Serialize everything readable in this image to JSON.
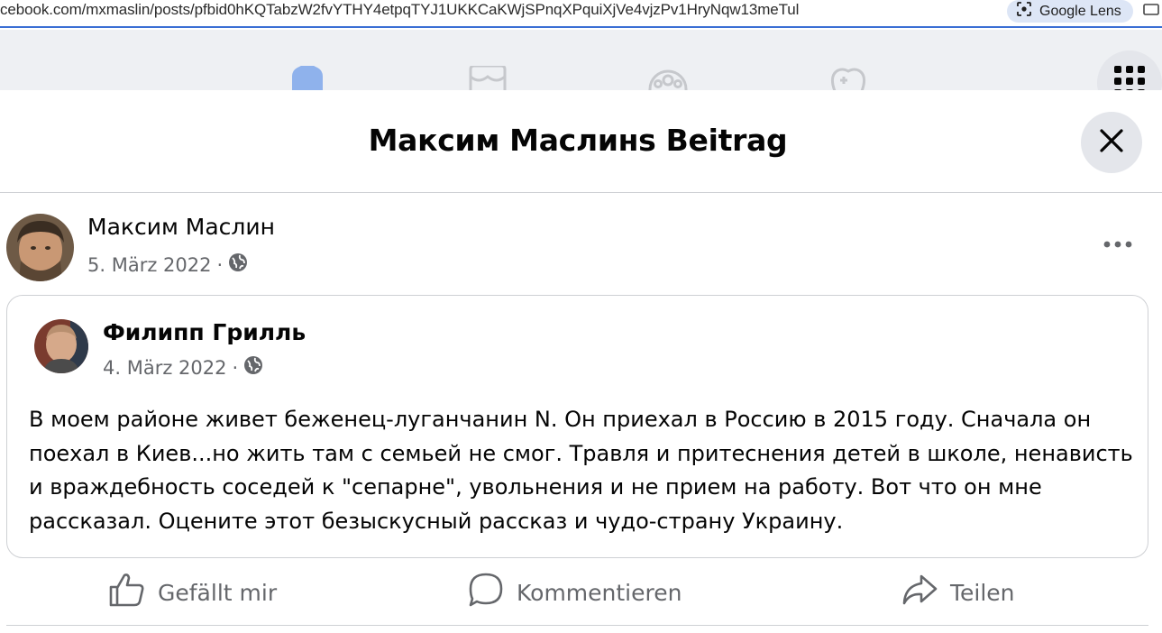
{
  "browser": {
    "url": "cebook.com/mxmaslin/posts/pfbid0hKQTabzW2fvYTHY4etpqTYJ1UKKCaKWjSPnqXPquiXjVe4vjzPv1HryNqw13meTul",
    "lens_label": "Google Lens"
  },
  "icons": {
    "lens": "google-lens-icon",
    "nav": [
      "home-icon",
      "marketplace-icon",
      "groups-icon",
      "gaming-icon"
    ],
    "apps": "apps-grid-icon",
    "close": "close-icon",
    "more": "more-options-icon",
    "audience": "globe-icon",
    "like": "thumbs-up-icon",
    "comment": "comment-bubble-icon",
    "share": "share-arrow-icon"
  },
  "colors": {
    "accent": "#1877f2",
    "text_primary": "#050505",
    "text_secondary": "#65676b",
    "button_bg": "#e4e6eb",
    "divider": "#ced0d4"
  },
  "modal": {
    "title": "Максим Маслинs Beitrag"
  },
  "post": {
    "author": "Максим Маслин",
    "date": "5. März 2022",
    "separator": "·",
    "shared": {
      "author": "Филипп Грилль",
      "date": "4. März 2022",
      "separator": "·",
      "text": "В моем районе живет беженец-луганчанин N. Он приехал в Россию в 2015 году. Сначала он поехал в Киев...но жить там с семьей не смог. Травля и притеснения детей в школе, ненависть и враждебность соседей к \"сепарне\", увольнения и не прием на работу. Вот что он мне рассказал. Оцените этот безыскусный рассказ и чудо-страну Украину."
    }
  },
  "actions": {
    "like": "Gefällt mir",
    "comment": "Kommentieren",
    "share": "Teilen"
  }
}
